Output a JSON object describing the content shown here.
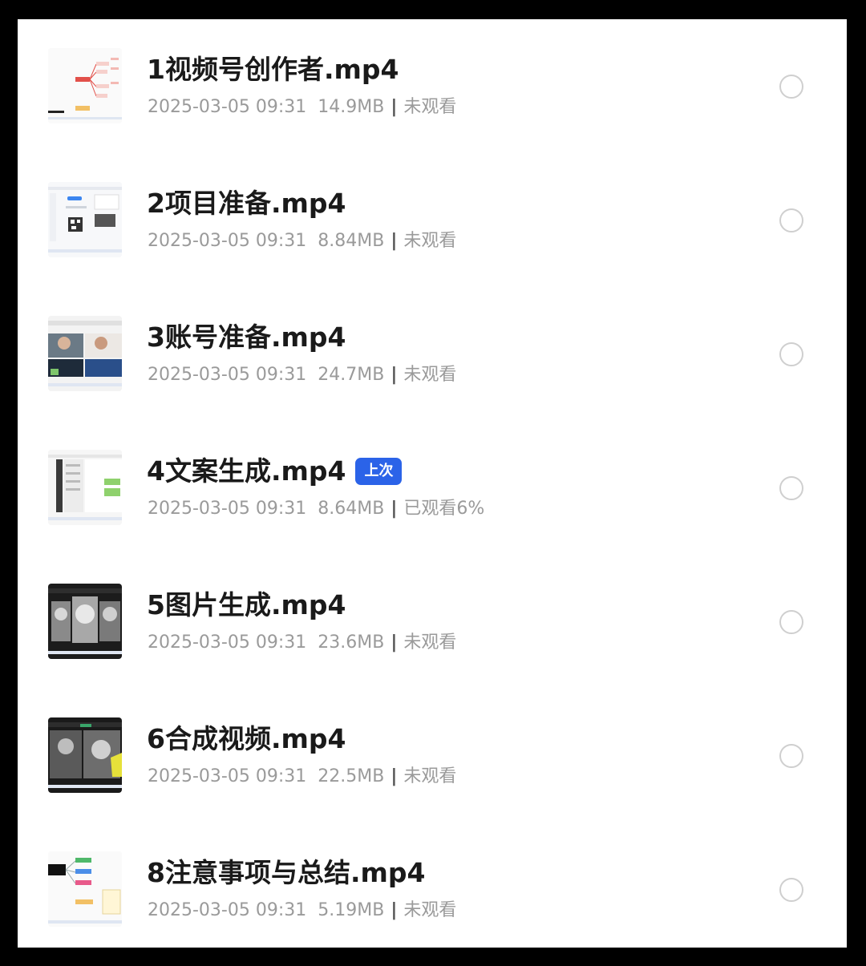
{
  "files": [
    {
      "name": "1视频号创作者.mp4",
      "date": "2025-03-05 09:31",
      "size": "14.9MB",
      "status": "未观看",
      "badge": "",
      "thumb": "mindmap-thumbnail"
    },
    {
      "name": "2项目准备.mp4",
      "date": "2025-03-05 09:31",
      "size": "8.84MB",
      "status": "未观看",
      "badge": "",
      "thumb": "qr-screen-thumbnail"
    },
    {
      "name": "3账号准备.mp4",
      "date": "2025-03-05 09:31",
      "size": "24.7MB",
      "status": "未观看",
      "badge": "",
      "thumb": "video-feed-thumbnail"
    },
    {
      "name": "4文案生成.mp4",
      "date": "2025-03-05 09:31",
      "size": "8.64MB",
      "status": "已观看6%",
      "badge": "上次",
      "thumb": "chat-screen-thumbnail"
    },
    {
      "name": "5图片生成.mp4",
      "date": "2025-03-05 09:31",
      "size": "23.6MB",
      "status": "未观看",
      "badge": "",
      "thumb": "portrait-gallery-thumbnail"
    },
    {
      "name": "6合成视频.mp4",
      "date": "2025-03-05 09:31",
      "size": "22.5MB",
      "status": "未观看",
      "badge": "",
      "thumb": "video-editor-thumbnail"
    },
    {
      "name": "8注意事项与总结.mp4",
      "date": "2025-03-05 09:31",
      "size": "5.19MB",
      "status": "未观看",
      "badge": "",
      "thumb": "summary-mindmap-thumbnail"
    }
  ],
  "colors": {
    "badge": "#2b63e8",
    "title": "#1a1a1a",
    "meta": "#9a9a9a",
    "radio_border": "#cfcfcf"
  }
}
